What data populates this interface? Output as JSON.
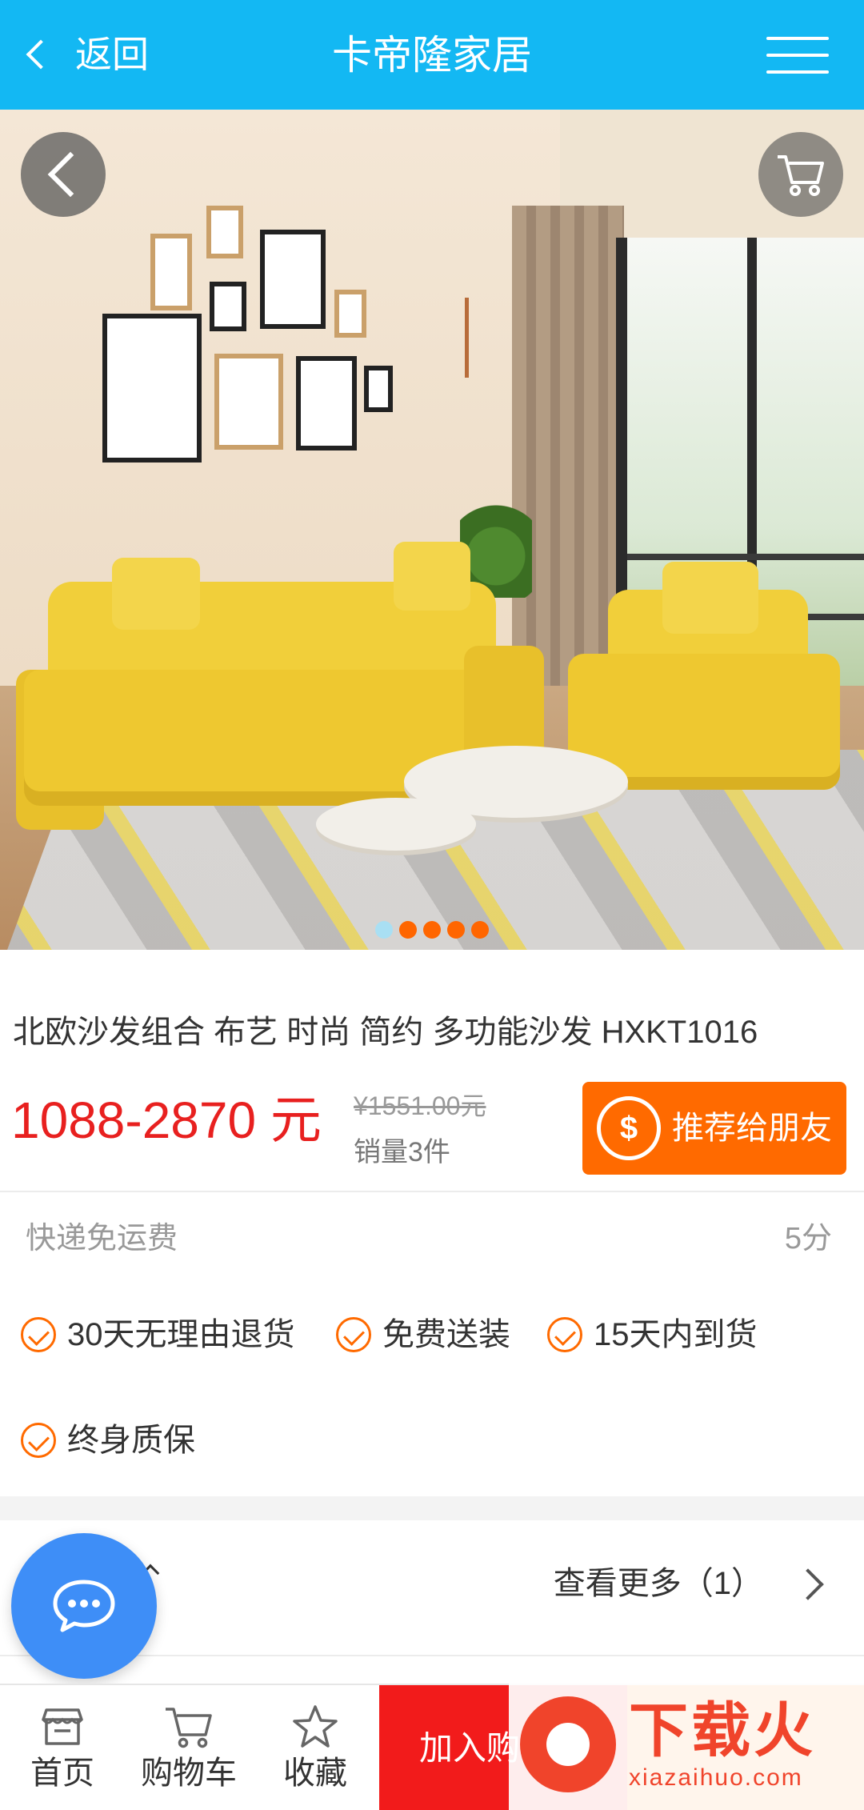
{
  "header": {
    "back_label": "返回",
    "title": "卡帝隆家居"
  },
  "hero": {
    "slide_count": 5,
    "active_slide": 1
  },
  "product": {
    "title": "北欧沙发组合 布艺 时尚 简约 多功能沙发 HXKT1016",
    "price": "1088-2870 元",
    "original_price": "¥1551.00元",
    "sales": "销量3件",
    "recommend_label": "推荐给朋友",
    "coin_symbol": "$"
  },
  "service": {
    "shipping": "快递免运费",
    "score": "5分",
    "badges": [
      "30天无理由退货",
      "免费送装",
      "15天内到货",
      "终身质保"
    ]
  },
  "reviews": {
    "more_label": "查看更多（1）"
  },
  "bottom_bar": {
    "tabs": [
      {
        "label": "首页",
        "icon": "store-icon"
      },
      {
        "label": "购物车",
        "icon": "cart-icon"
      },
      {
        "label": "收藏",
        "icon": "star-icon"
      }
    ],
    "add_cart_label": "加入购物车"
  },
  "watermark": {
    "title": "下载火",
    "subtitle": "xiazaihuo.com"
  },
  "colors": {
    "header": "#13b8f3",
    "price": "#e8201f",
    "accent": "#ff6a00",
    "add_cart": "#f21b1b",
    "chat": "#3e8ef7"
  }
}
